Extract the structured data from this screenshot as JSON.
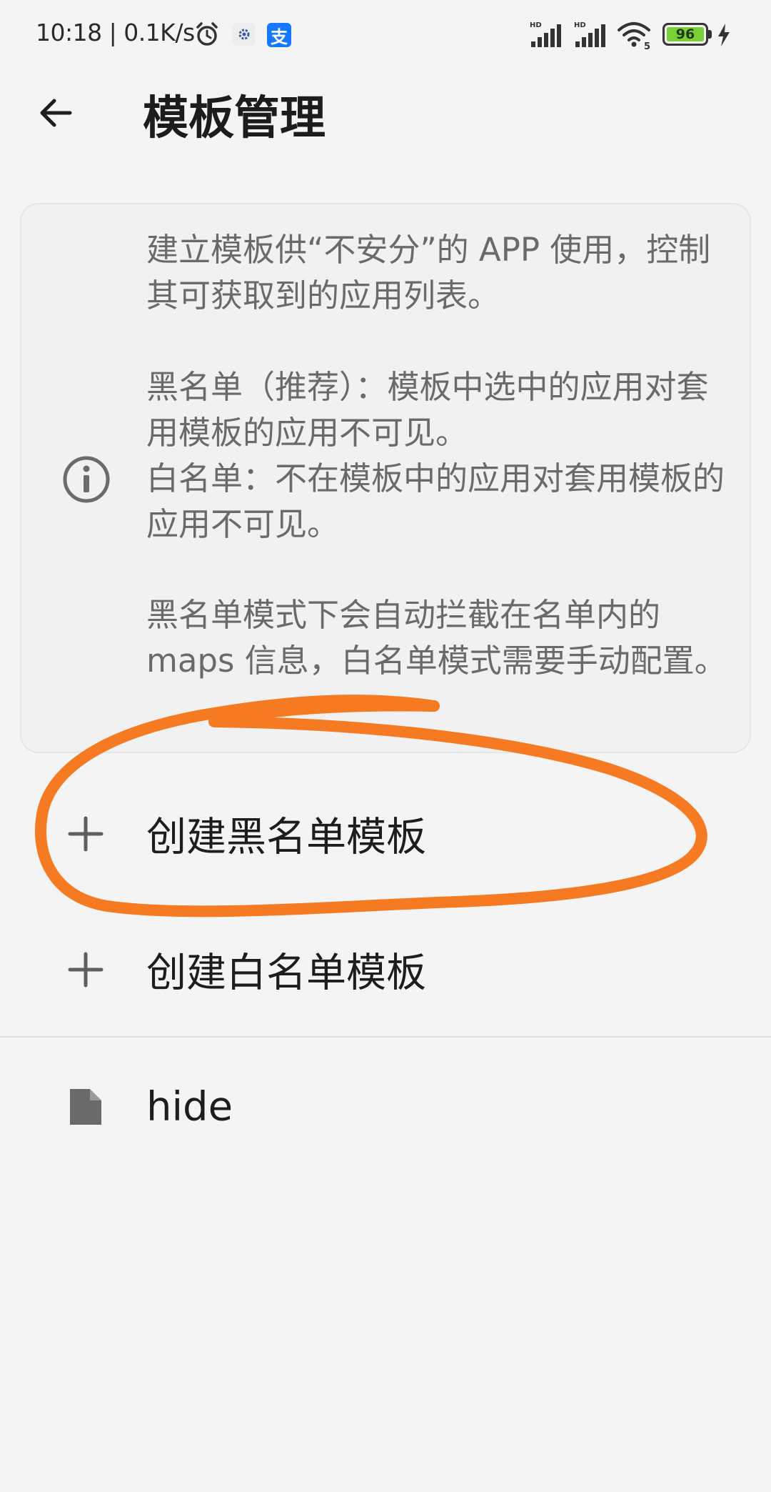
{
  "status_bar": {
    "time_speed": "10:18 | 0.1K/s",
    "battery_level": "96",
    "signal_1_label": "HD",
    "signal_2_label": "HD",
    "wifi_label": "5",
    "colors": {
      "battery_fill": "#7bd03a"
    }
  },
  "header": {
    "title": "模板管理",
    "back_icon": "arrow-back-icon"
  },
  "info_card": {
    "icon": "info-icon",
    "paragraph_1": "建立模板供“不安分”的 APP 使用，控制其可获取到的应用列表。",
    "paragraph_2_line_1": "黑名单（推荐）：模板中选中的应用对套用模板的应用不可见。",
    "paragraph_2_line_2": "白名单：不在模板中的应用对套用模板的应用不可见。",
    "paragraph_3": "黑名单模式下会自动拦截在名单内的 maps 信息，白名单模式需要手动配置。"
  },
  "actions": [
    {
      "label": "创建黑名单模板",
      "icon": "plus-icon"
    },
    {
      "label": "创建白名单模板",
      "icon": "plus-icon"
    }
  ],
  "templates": [
    {
      "label": "hide",
      "icon": "document-icon"
    }
  ],
  "annotation": {
    "color": "#f57a22",
    "shape": "hand-drawn ellipse around create-blacklist row"
  }
}
